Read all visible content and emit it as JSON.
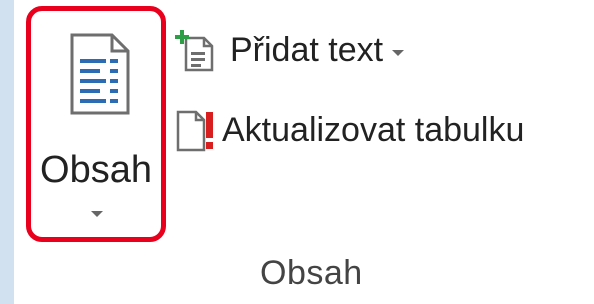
{
  "ribbon_group": {
    "name": "Obsah",
    "toc_button": {
      "label": "Obsah",
      "icon": "table-of-contents-icon",
      "has_dropdown": true,
      "highlight_color": "#e8001c"
    },
    "commands": [
      {
        "label": "Přidat text",
        "icon": "add-text-icon",
        "has_dropdown": true
      },
      {
        "label": "Aktualizovat tabulku",
        "icon": "update-table-icon",
        "has_dropdown": false
      }
    ]
  },
  "colors": {
    "background": "#d2e1ef",
    "panel": "#ffffff",
    "icon_accent_green": "#2e9e46",
    "icon_accent_red": "#d81e1e"
  }
}
